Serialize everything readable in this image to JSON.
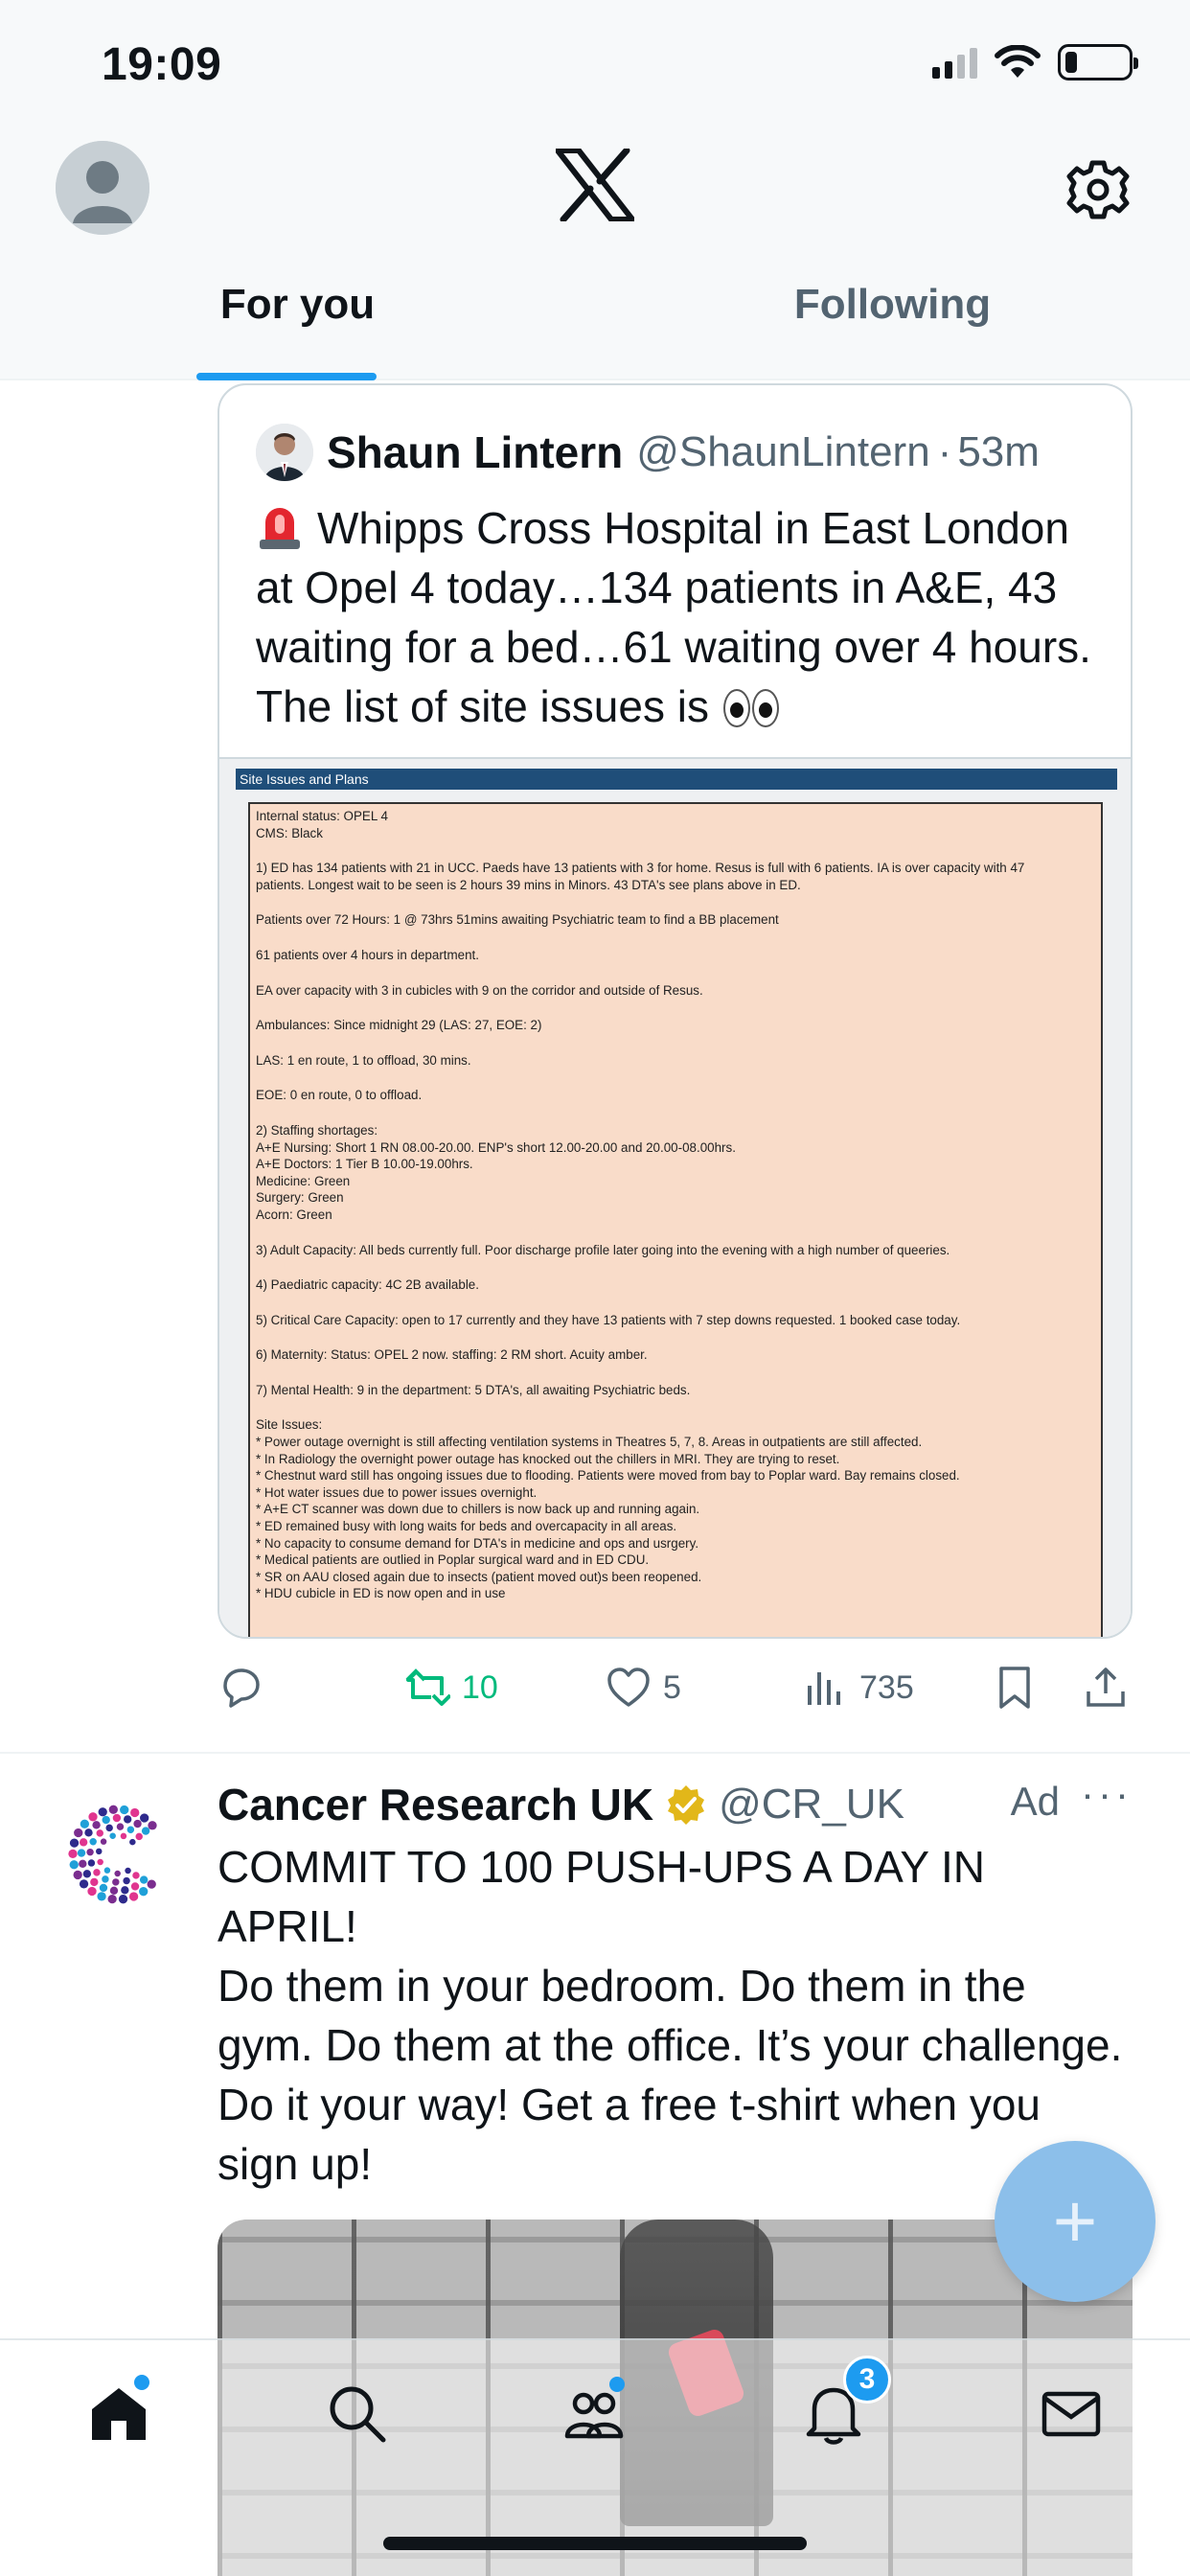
{
  "status_bar": {
    "time": "19:09"
  },
  "header": {
    "logo": "x-logo",
    "settings_icon": "gear-icon",
    "tabs": [
      {
        "label": "For you",
        "active": true
      },
      {
        "label": "Following",
        "active": false
      }
    ]
  },
  "quoted_tweet": {
    "author_name": "Shaun Lintern",
    "handle": "@ShaunLintern",
    "separator": "·",
    "time": "53m",
    "text": "Whipps Cross Hospital in East London at Opel 4 today…134 patients in A&E, 43 waiting for a bed…61 waiting over 4 hours. The list of site issues is",
    "image": {
      "header_bar": "Site Issues and Plans",
      "lines": [
        "Internal status: OPEL 4",
        "CMS: Black",
        "",
        "1) ED has 134 patients with 21 in UCC. Paeds have 13 patients with 3 for home. Resus is full with 6 patients. IA is over capacity with 47",
        "patients. Longest wait to be seen is 2 hours 39 mins in Minors. 43 DTA's see plans above in ED.",
        "",
        "Patients over 72 Hours: 1 @ 73hrs 51mins awaiting Psychiatric team to find a BB placement",
        "",
        "61 patients over 4 hours in department.",
        "",
        "EA over capacity with 3 in cubicles with 9 on the corridor and outside of Resus.",
        "",
        "Ambulances:  Since midnight 29 (LAS: 27, EOE: 2)",
        "",
        "LAS:  1 en route, 1 to offload, 30 mins.",
        "",
        "EOE: 0 en route, 0 to offload.",
        "",
        "2) Staffing shortages:",
        "A+E Nursing: Short 1 RN 08.00-20.00.  ENP's short 12.00-20.00 and 20.00-08.00hrs.",
        "A+E Doctors: 1 Tier B 10.00-19.00hrs.",
        "Medicine: Green",
        "Surgery: Green",
        "Acorn: Green",
        "",
        "3) Adult Capacity: All beds currently full. Poor discharge profile later going into the evening with a high number of queeries.",
        "",
        "4) Paediatric capacity: 4C 2B available.",
        "",
        "5) Critical Care Capacity: open to 17 currently and they have 13 patients with 7 step downs requested. 1 booked case today.",
        "",
        "6) Maternity: Status: OPEL 2 now. staffing: 2 RM short. Acuity amber.",
        "",
        "7) Mental Health: 9 in the department: 5 DTA's, all awaiting Psychiatric beds.",
        "",
        "Site Issues:",
        "* Power outage overnight is still affecting ventilation systems in Theatres 5, 7, 8. Areas in outpatients are still affected.",
        "* In Radiology the overnight power outage has knocked out the chillers in MRI. They are trying to reset.",
        "* Chestnut ward still has ongoing issues due to flooding. Patients were moved from bay to Poplar ward. Bay remains closed.",
        "* Hot water issues due to power issues overnight.",
        "* A+E CT scanner was down due to chillers is now back up and running again.",
        "* ED remained busy with long waits for beds and overcapacity in all areas.",
        "* No capacity to consume demand for DTA's in medicine and ops and usrgery.",
        "* Medical patients are outlied in Poplar surgical ward and in ED CDU.",
        "* SR on AAU closed again due to insects (patient moved out)s been reopened.",
        "* HDU cubicle in ED is now open and in use"
      ]
    }
  },
  "tweet_actions": {
    "reply_count": "",
    "retweet_count": "10",
    "like_count": "5",
    "view_count": "735",
    "retweeted": true
  },
  "ad_tweet": {
    "author_name": "Cancer Research UK",
    "handle": "@CR_UK",
    "ad_label": "Ad",
    "more": "···",
    "text_line1": "COMMIT TO 100 PUSH-UPS A DAY IN APRIL!",
    "text_line2": "Do them in your bedroom. Do them in the gym. Do them at the office. It’s your challenge. Do it your way! Get a free t-shirt when you sign up!"
  },
  "fab": {
    "label": "+"
  },
  "bottom_nav": {
    "items": [
      "home-icon",
      "search-icon",
      "communities-icon",
      "notifications-icon",
      "messages-icon"
    ],
    "notifications_badge": "3"
  },
  "colors": {
    "accent": "#1d9bf0",
    "retweet_green": "#00ba7c",
    "secondary_text": "#536471",
    "doc_background": "#f9dcc9"
  }
}
